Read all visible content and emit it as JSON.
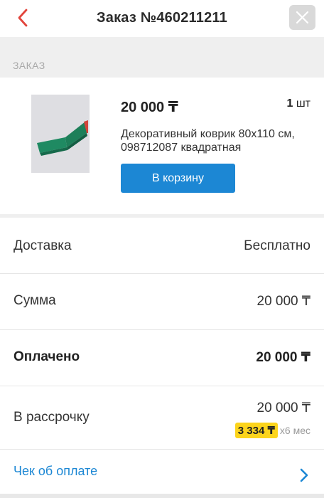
{
  "header": {
    "title": "Заказ №460211211"
  },
  "order": {
    "section_label": "ЗАКАЗ",
    "product": {
      "price": "20 000 ₸",
      "quantity": "1",
      "quantity_unit": "шт",
      "name": "Декоративный коврик 80х110 см, 098712087 квадратная",
      "cart_button_label": "В корзину"
    }
  },
  "summary": {
    "delivery": {
      "label": "Доставка",
      "value": "Бесплатно"
    },
    "sum": {
      "label": "Сумма",
      "value": "20 000 ₸"
    },
    "paid": {
      "label": "Оплачено",
      "value": "20 000 ₸"
    },
    "installment": {
      "label": "В рассрочку",
      "value": "20 000 ₸",
      "monthly_amount": "3 334 ₸",
      "term": "х6 мес"
    },
    "receipt": {
      "label": "Чек об оплате"
    }
  },
  "colors": {
    "accent_blue": "#1c87d4",
    "back_red": "#e2453c",
    "installment_yellow": "#fcd41c"
  },
  "icons": {
    "back": "chevron-left-icon",
    "close": "close-icon",
    "receipt_arrow": "chevron-right-icon"
  }
}
